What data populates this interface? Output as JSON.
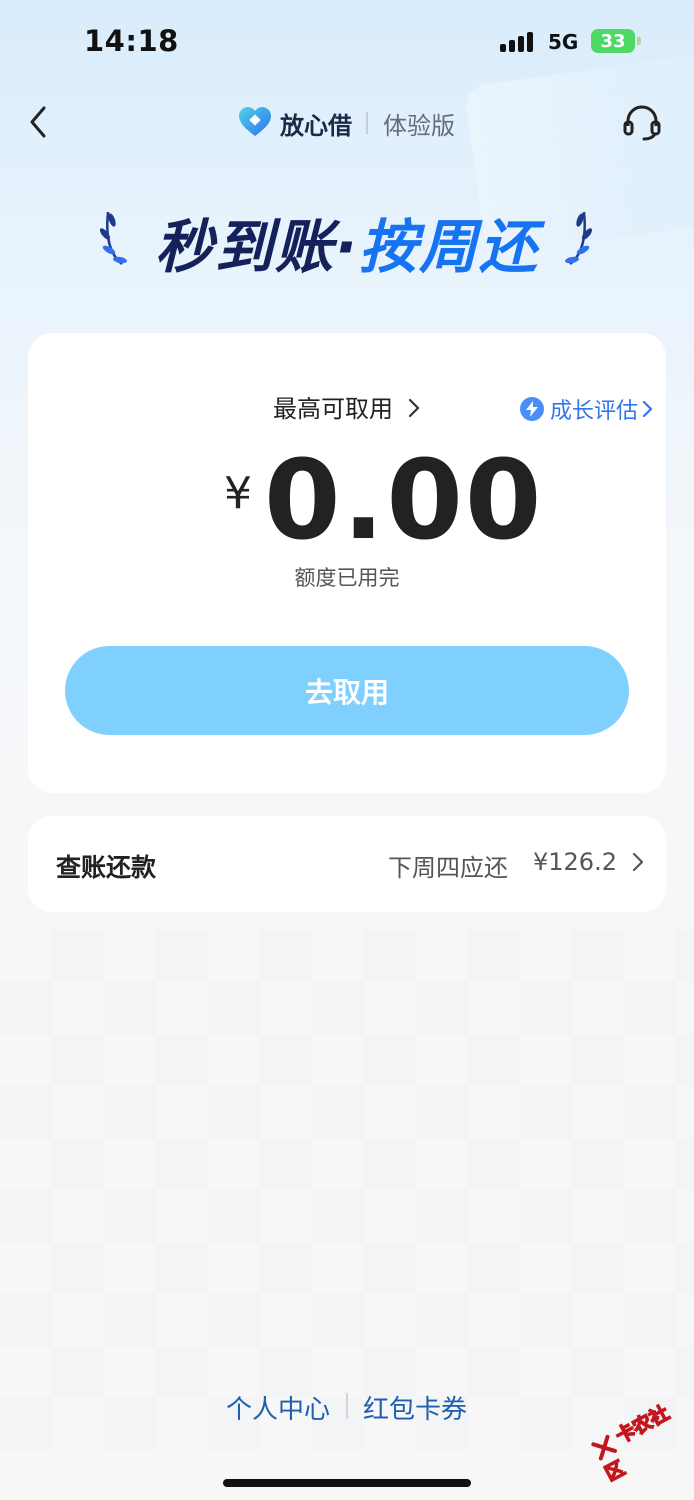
{
  "status_bar": {
    "time": "14:18",
    "network": "5G",
    "battery": "33"
  },
  "header": {
    "brand": "放心借",
    "version": "体验版"
  },
  "slogan": {
    "part1": "秒到账",
    "dot": "·",
    "part2": "按周还"
  },
  "credit": {
    "max_label": "最高可取用",
    "growth_label": "成长评估",
    "currency": "¥",
    "amount": "0.00",
    "quota_status": "额度已用完",
    "draw_button": "去取用"
  },
  "repay": {
    "title": "查账还款",
    "due_label": "下周四应还",
    "due_amount": "¥126.2"
  },
  "bottom_links": {
    "personal_center": "个人中心",
    "coupons": "红包卡券"
  },
  "watermark": {
    "text": "卡农社区"
  },
  "colors": {
    "accent": "#1673f2",
    "button": "#7fcfff",
    "slogan_dark": "#14215a",
    "link": "#1f5fb0"
  }
}
